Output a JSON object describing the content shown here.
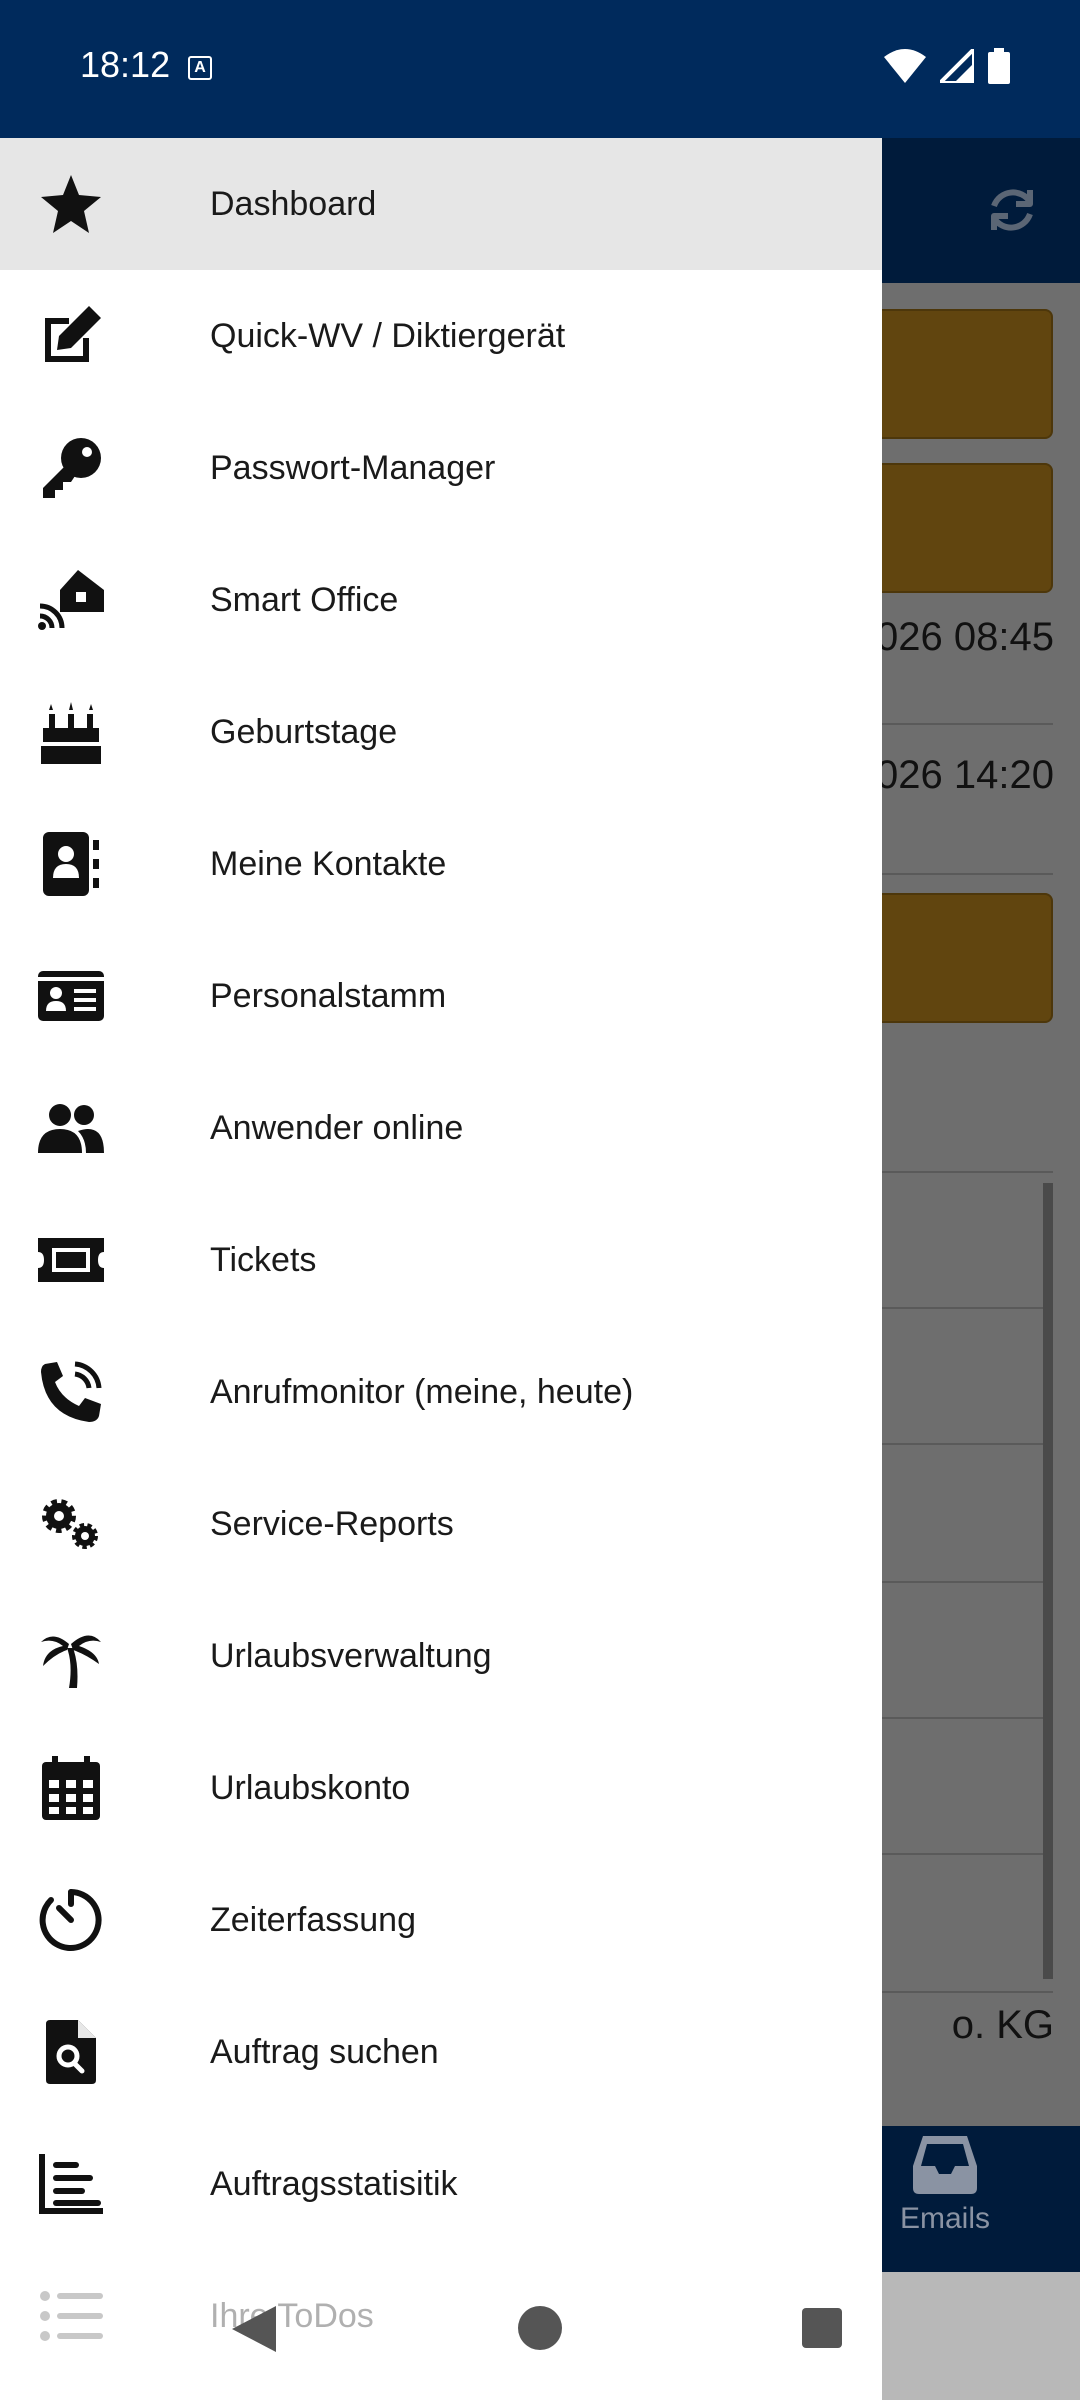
{
  "status_bar": {
    "time": "18:12",
    "indicator_letter": "A",
    "icons": [
      "wifi-icon",
      "signal-icon",
      "battery-icon"
    ]
  },
  "background_app": {
    "rows": [
      {
        "text": "026 08:45"
      },
      {
        "text": "026 14:20"
      },
      {
        "text": "o. KG"
      }
    ],
    "bottom_nav": {
      "emails_label": "Emails"
    }
  },
  "drawer": {
    "items": [
      {
        "label": "Dashboard",
        "icon": "star-icon",
        "active": true
      },
      {
        "label": "Quick-WV / Diktiergerät",
        "icon": "edit-icon"
      },
      {
        "label": "Passwort-Manager",
        "icon": "key-icon"
      },
      {
        "label": "Smart Office",
        "icon": "smart-home-icon"
      },
      {
        "label": "Geburtstage",
        "icon": "birthday-cake-icon"
      },
      {
        "label": "Meine Kontakte",
        "icon": "address-book-icon"
      },
      {
        "label": "Personalstamm",
        "icon": "id-card-icon"
      },
      {
        "label": "Anwender online",
        "icon": "users-icon"
      },
      {
        "label": "Tickets",
        "icon": "ticket-icon"
      },
      {
        "label": "Anrufmonitor (meine, heute)",
        "icon": "phone-volume-icon"
      },
      {
        "label": "Service-Reports",
        "icon": "cogs-icon"
      },
      {
        "label": "Urlaubsverwaltung",
        "icon": "palm-tree-icon"
      },
      {
        "label": "Urlaubskonto",
        "icon": "calendar-icon"
      },
      {
        "label": "Zeiterfassung",
        "icon": "timer-icon"
      },
      {
        "label": "Auftrag suchen",
        "icon": "file-search-icon"
      },
      {
        "label": "Auftragsstatisitik",
        "icon": "chart-bar-icon"
      },
      {
        "label": "Ihre ToDos",
        "icon": "list-icon",
        "faded": true
      }
    ]
  },
  "colors": {
    "status_bar": "#002a5c",
    "drawer_bg": "#ffffff",
    "active_item_bg": "#e6e6e6",
    "card_amber_dimmed": "#61450f"
  }
}
